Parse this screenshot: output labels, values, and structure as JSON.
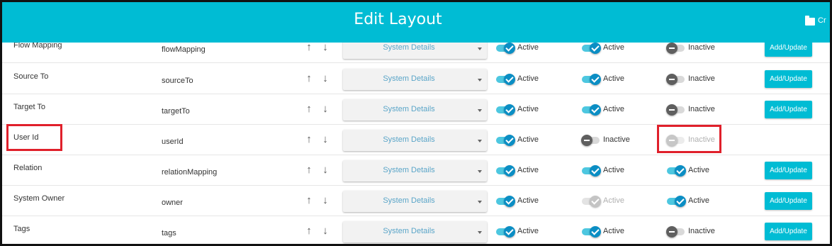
{
  "header": {
    "title": "Edit Layout",
    "cr_text": "Cr",
    "folder_icon": "folder-icon"
  },
  "colors": {
    "header_bg": "#00bcd4",
    "toggle_on": "#0b8ec4",
    "button_bg": "#00bcd4",
    "highlight": "#e0202b"
  },
  "rows": [
    {
      "label": "Flow Mapping",
      "field": "flowMapping",
      "dropdown": "System Details",
      "t1": {
        "label": "Active",
        "state": "on"
      },
      "t2": {
        "label": "Active",
        "state": "on"
      },
      "t3": {
        "label": "Inactive",
        "state": "off"
      },
      "button": "Add/Update"
    },
    {
      "label": "Source To",
      "field": "sourceTo",
      "dropdown": "System Details",
      "t1": {
        "label": "Active",
        "state": "on"
      },
      "t2": {
        "label": "Active",
        "state": "on"
      },
      "t3": {
        "label": "Inactive",
        "state": "off"
      },
      "button": "Add/Update"
    },
    {
      "label": "Target To",
      "field": "targetTo",
      "dropdown": "System Details",
      "t1": {
        "label": "Active",
        "state": "on"
      },
      "t2": {
        "label": "Active",
        "state": "on"
      },
      "t3": {
        "label": "Inactive",
        "state": "off"
      },
      "button": "Add/Update"
    },
    {
      "label": "User Id",
      "field": "userId",
      "dropdown": "System Details",
      "t1": {
        "label": "Active",
        "state": "on"
      },
      "t2": {
        "label": "Inactive",
        "state": "off"
      },
      "t3": {
        "label": "Inactive",
        "state": "dis-off"
      },
      "button": null
    },
    {
      "label": "Relation",
      "field": "relationMapping",
      "dropdown": "System Details",
      "t1": {
        "label": "Active",
        "state": "on"
      },
      "t2": {
        "label": "Active",
        "state": "on"
      },
      "t3": {
        "label": "Active",
        "state": "on"
      },
      "button": "Add/Update"
    },
    {
      "label": "System Owner",
      "field": "owner",
      "dropdown": "System Details",
      "t1": {
        "label": "Active",
        "state": "on"
      },
      "t2": {
        "label": "Active",
        "state": "dis-on"
      },
      "t3": {
        "label": "Active",
        "state": "on"
      },
      "button": "Add/Update"
    },
    {
      "label": "Tags",
      "field": "tags",
      "dropdown": "System Details",
      "t1": {
        "label": "Active",
        "state": "on"
      },
      "t2": {
        "label": "Active",
        "state": "on"
      },
      "t3": {
        "label": "Inactive",
        "state": "off"
      },
      "button": "Add/Update"
    }
  ],
  "arrows": {
    "up": "↑",
    "down": "↓"
  }
}
